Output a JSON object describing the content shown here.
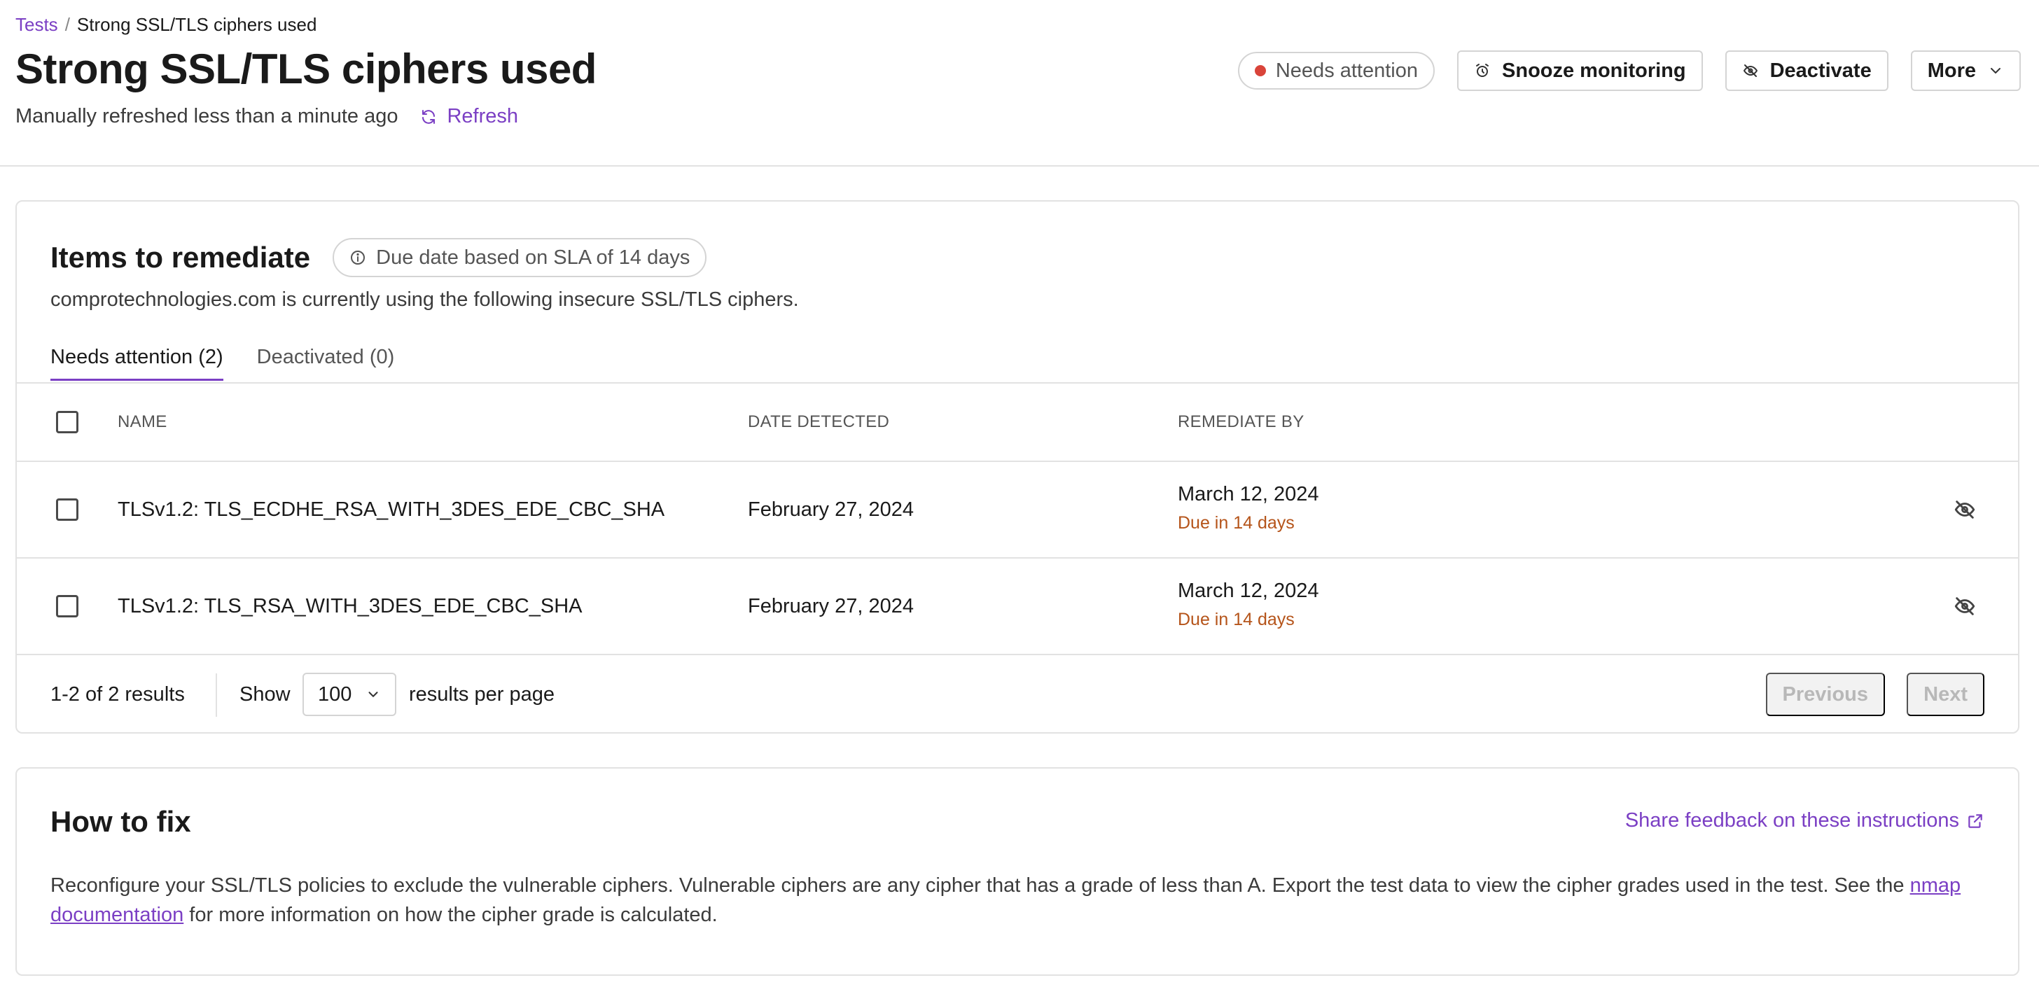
{
  "breadcrumb": {
    "root": "Tests",
    "separator": "/",
    "current": "Strong SSL/TLS ciphers used"
  },
  "page": {
    "title": "Strong SSL/TLS ciphers used",
    "refresh_status": "Manually refreshed less than a minute ago",
    "refresh_label": "Refresh"
  },
  "header_actions": {
    "status_label": "Needs attention",
    "status_color": "#d9443a",
    "snooze_label": "Snooze monitoring",
    "deactivate_label": "Deactivate",
    "more_label": "More"
  },
  "remediate": {
    "title": "Items to remediate",
    "sla_label": "Due date based on SLA of 14 days",
    "description": "comprotechnologies.com is currently using the following insecure SSL/TLS ciphers.",
    "tabs": [
      {
        "label": "Needs attention (2)",
        "active": true
      },
      {
        "label": "Deactivated (0)",
        "active": false
      }
    ],
    "columns": {
      "name": "NAME",
      "date_detected": "DATE DETECTED",
      "remediate_by": "REMEDIATE BY"
    },
    "rows": [
      {
        "name": "TLSv1.2: TLS_ECDHE_RSA_WITH_3DES_EDE_CBC_SHA",
        "date_detected": "February 27, 2024",
        "remediate_by": "March 12, 2024",
        "due": "Due in 14 days"
      },
      {
        "name": "TLSv1.2: TLS_RSA_WITH_3DES_EDE_CBC_SHA",
        "date_detected": "February 27, 2024",
        "remediate_by": "March 12, 2024",
        "due": "Due in 14 days"
      }
    ],
    "pagination": {
      "results": "1-2 of 2 results",
      "show_label": "Show",
      "per_page": "100",
      "per_page_label": "results per page",
      "previous_label": "Previous",
      "next_label": "Next"
    }
  },
  "how_to_fix": {
    "title": "How to fix",
    "feedback_label": "Share feedback on these instructions",
    "text_before": "Reconfigure your SSL/TLS policies to exclude the vulnerable ciphers. Vulnerable ciphers are any cipher that has a grade of less than A. Export the test data to view the cipher grades used in the test. See the ",
    "link_text": "nmap documentation",
    "text_after": " for more information on how the cipher grade is calculated."
  },
  "colors": {
    "accent": "#7b3fc4",
    "due_text": "#b5541a",
    "status_dot": "#d9443a"
  },
  "icons": {
    "refresh": "refresh-icon",
    "snooze": "alarm-clock-icon",
    "deactivate": "eye-off-icon",
    "more": "chevron-down-icon",
    "info": "info-icon",
    "row_action": "eye-off-icon",
    "select": "chevron-down-icon",
    "feedback": "external-link-icon"
  }
}
